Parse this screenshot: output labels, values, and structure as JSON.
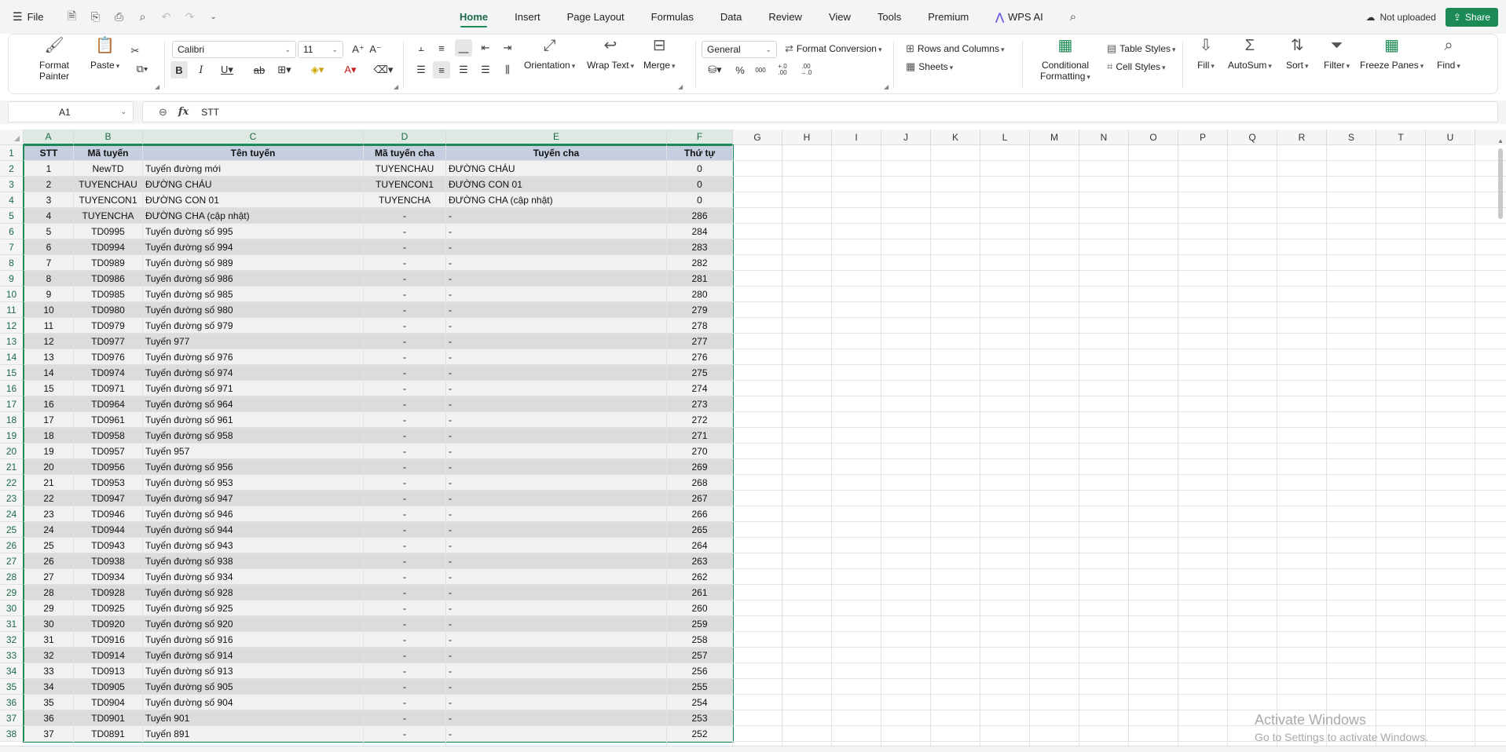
{
  "menu": {
    "file_label": "File",
    "tabs": [
      "Home",
      "Insert",
      "Page Layout",
      "Formulas",
      "Data",
      "Review",
      "View",
      "Tools",
      "Premium",
      "WPS AI"
    ],
    "active_tab": "Home",
    "status": "Not uploaded",
    "share_label": "Share"
  },
  "ribbon": {
    "format_painter": "Format Painter",
    "paste": "Paste",
    "font_name": "Calibri",
    "font_size": "11",
    "orientation": "Orientation",
    "wrap_text": "Wrap Text",
    "merge": "Merge",
    "number_format": "General",
    "format_conversion": "Format Conversion",
    "rows_and_columns": "Rows and Columns",
    "sheets": "Sheets",
    "conditional_formatting": "Conditional Formatting",
    "table_styles": "Table Styles",
    "cell_styles": "Cell Styles",
    "fill": "Fill",
    "autosum": "AutoSum",
    "sort": "Sort",
    "filter": "Filter",
    "freeze_panes": "Freeze Panes",
    "find": "Find",
    "percent": "%",
    "thousands": "000",
    "inc_decimal": "+.0 .00",
    "dec_decimal": ".00 →.0"
  },
  "formula_bar": {
    "cell_ref": "A1",
    "fx": "fx",
    "value": "STT"
  },
  "columns": [
    "A",
    "B",
    "C",
    "D",
    "E",
    "F",
    "G",
    "H",
    "I",
    "J",
    "K",
    "L",
    "M",
    "N",
    "O",
    "P",
    "Q",
    "R",
    "S",
    "T",
    "U"
  ],
  "table": {
    "headers": [
      "STT",
      "Mã tuyến",
      "Tên tuyến",
      "Mã tuyến cha",
      "Tuyến cha",
      "Thứ tự"
    ],
    "rows": [
      [
        "1",
        "NewTD",
        "Tuyến đường mới",
        "TUYENCHAU",
        "ĐƯỜNG CHÁU",
        "0"
      ],
      [
        "2",
        "TUYENCHAU",
        "ĐƯỜNG CHÁU",
        "TUYENCON1",
        "ĐƯỜNG CON 01",
        "0"
      ],
      [
        "3",
        "TUYENCON1",
        "ĐƯỜNG CON 01",
        "TUYENCHA",
        "ĐƯỜNG CHA (cập nhật)",
        "0"
      ],
      [
        "4",
        "TUYENCHA",
        "ĐƯỜNG CHA (cập nhật)",
        "-",
        "-",
        "286"
      ],
      [
        "5",
        "TD0995",
        "Tuyến đường số 995",
        "-",
        "-",
        "284"
      ],
      [
        "6",
        "TD0994",
        "Tuyến đường số 994",
        "-",
        "-",
        "283"
      ],
      [
        "7",
        "TD0989",
        "Tuyến đường số 989",
        "-",
        "-",
        "282"
      ],
      [
        "8",
        "TD0986",
        "Tuyến đường số 986",
        "-",
        "-",
        "281"
      ],
      [
        "9",
        "TD0985",
        "Tuyến đường số 985",
        "-",
        "-",
        "280"
      ],
      [
        "10",
        "TD0980",
        "Tuyến đường số 980",
        "-",
        "-",
        "279"
      ],
      [
        "11",
        "TD0979",
        "Tuyến đường số 979",
        "-",
        "-",
        "278"
      ],
      [
        "12",
        "TD0977",
        "Tuyến 977",
        "-",
        "-",
        "277"
      ],
      [
        "13",
        "TD0976",
        "Tuyến đường số 976",
        "-",
        "-",
        "276"
      ],
      [
        "14",
        "TD0974",
        "Tuyến đường số 974",
        "-",
        "-",
        "275"
      ],
      [
        "15",
        "TD0971",
        "Tuyến đường số 971",
        "-",
        "-",
        "274"
      ],
      [
        "16",
        "TD0964",
        "Tuyến đường số 964",
        "-",
        "-",
        "273"
      ],
      [
        "17",
        "TD0961",
        "Tuyến đường số 961",
        "-",
        "-",
        "272"
      ],
      [
        "18",
        "TD0958",
        "Tuyến đường số 958",
        "-",
        "-",
        "271"
      ],
      [
        "19",
        "TD0957",
        "Tuyến 957",
        "-",
        "-",
        "270"
      ],
      [
        "20",
        "TD0956",
        "Tuyến đường số 956",
        "-",
        "-",
        "269"
      ],
      [
        "21",
        "TD0953",
        "Tuyến đường số 953",
        "-",
        "-",
        "268"
      ],
      [
        "22",
        "TD0947",
        "Tuyến đường số 947",
        "-",
        "-",
        "267"
      ],
      [
        "23",
        "TD0946",
        "Tuyến đường số 946",
        "-",
        "-",
        "266"
      ],
      [
        "24",
        "TD0944",
        "Tuyến đường số 944",
        "-",
        "-",
        "265"
      ],
      [
        "25",
        "TD0943",
        "Tuyến đường số 943",
        "-",
        "-",
        "264"
      ],
      [
        "26",
        "TD0938",
        "Tuyến đường số 938",
        "-",
        "-",
        "263"
      ],
      [
        "27",
        "TD0934",
        "Tuyến đường số 934",
        "-",
        "-",
        "262"
      ],
      [
        "28",
        "TD0928",
        "Tuyến đường số 928",
        "-",
        "-",
        "261"
      ],
      [
        "29",
        "TD0925",
        "Tuyến đường số 925",
        "-",
        "-",
        "260"
      ],
      [
        "30",
        "TD0920",
        "Tuyến đường số 920",
        "-",
        "-",
        "259"
      ],
      [
        "31",
        "TD0916",
        "Tuyến đường số 916",
        "-",
        "-",
        "258"
      ],
      [
        "32",
        "TD0914",
        "Tuyến đường số 914",
        "-",
        "-",
        "257"
      ],
      [
        "33",
        "TD0913",
        "Tuyến đường số 913",
        "-",
        "-",
        "256"
      ],
      [
        "34",
        "TD0905",
        "Tuyến đường số 905",
        "-",
        "-",
        "255"
      ],
      [
        "35",
        "TD0904",
        "Tuyến đường số 904",
        "-",
        "-",
        "254"
      ],
      [
        "36",
        "TD0901",
        "Tuyến 901",
        "-",
        "-",
        "253"
      ],
      [
        "37",
        "TD0891",
        "Tuyến 891",
        "-",
        "-",
        "252"
      ]
    ]
  },
  "watermark": {
    "line1": "Activate Windows",
    "line2": "Go to Settings to activate Windows."
  },
  "colors": {
    "accent": "#1b8a55",
    "header_fill": "#c5cfdf",
    "row_fill_odd": "#f1f1f1",
    "row_fill_even": "#dcdcdc"
  }
}
